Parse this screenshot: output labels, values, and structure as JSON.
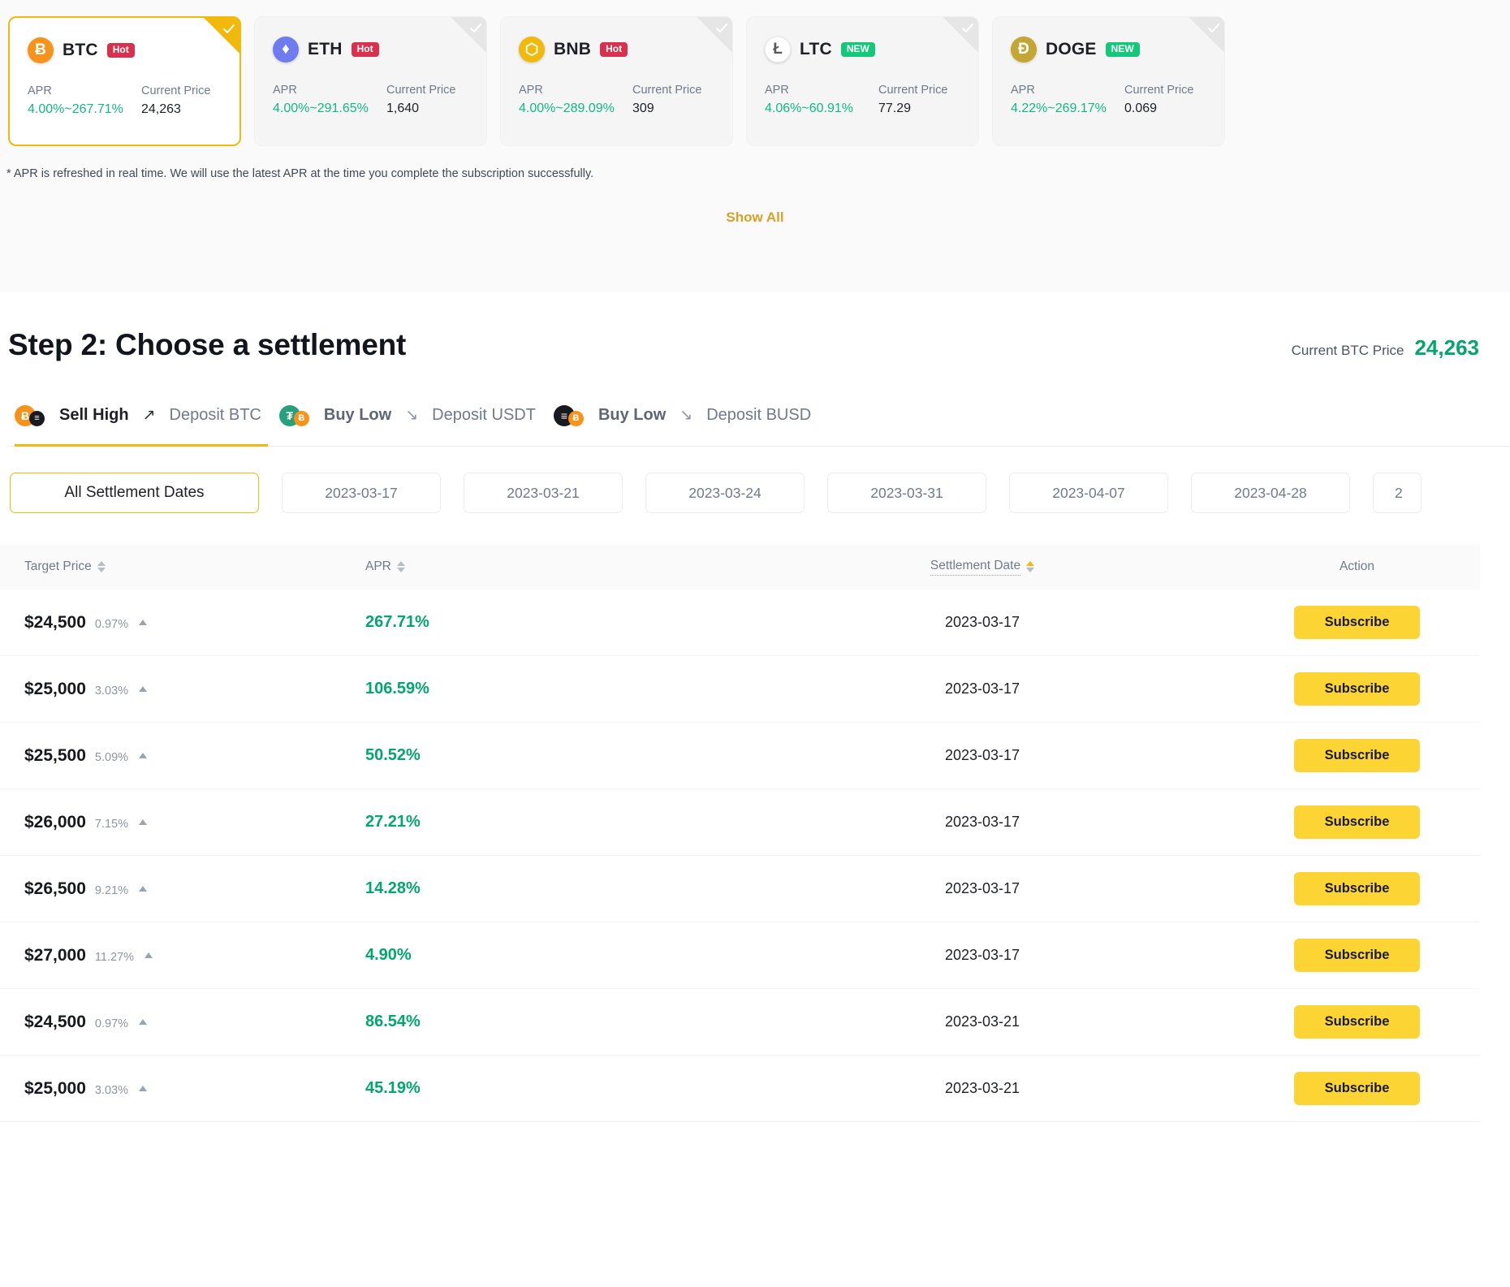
{
  "coin_cards": [
    {
      "symbol": "BTC",
      "badge": "Hot",
      "badge_type": "hot",
      "apr_label": "APR",
      "apr_value": "4.00%~267.71%",
      "price_label": "Current Price",
      "price_value": "24,263",
      "selected": true,
      "logo_glyph": "Ƀ",
      "logo_class": "logo-btc"
    },
    {
      "symbol": "ETH",
      "badge": "Hot",
      "badge_type": "hot",
      "apr_label": "APR",
      "apr_value": "4.00%~291.65%",
      "price_label": "Current Price",
      "price_value": "1,640",
      "selected": false,
      "logo_glyph": "♦",
      "logo_class": "logo-eth"
    },
    {
      "symbol": "BNB",
      "badge": "Hot",
      "badge_type": "hot",
      "apr_label": "APR",
      "apr_value": "4.00%~289.09%",
      "price_label": "Current Price",
      "price_value": "309",
      "selected": false,
      "logo_glyph": "⬡",
      "logo_class": "logo-bnb"
    },
    {
      "symbol": "LTC",
      "badge": "NEW",
      "badge_type": "new",
      "apr_label": "APR",
      "apr_value": "4.06%~60.91%",
      "price_label": "Current Price",
      "price_value": "77.29",
      "selected": false,
      "logo_glyph": "Ł",
      "logo_class": "logo-ltc"
    },
    {
      "symbol": "DOGE",
      "badge": "NEW",
      "badge_type": "new",
      "apr_label": "APR",
      "apr_value": "4.22%~269.17%",
      "price_label": "Current Price",
      "price_value": "0.069",
      "selected": false,
      "logo_glyph": "Đ",
      "logo_class": "logo-doge"
    }
  ],
  "apr_note": "* APR is refreshed in real time. We will use the latest APR at the time you complete the subscription successfully.",
  "show_all_label": "Show All",
  "step": {
    "title": "Step 2: Choose a settlement",
    "price_label": "Current BTC Price",
    "price_value": "24,263"
  },
  "settlement_tabs": [
    {
      "action": "Sell High",
      "arrow": "↗",
      "deposit": "Deposit BTC",
      "active": true,
      "icon_left": "Ƀ",
      "icon_left_class": "ic-btc",
      "icon_right": "≡",
      "icon_right_class": "ic-black"
    },
    {
      "action": "Buy Low",
      "arrow": "↘",
      "deposit": "Deposit USDT",
      "active": false,
      "icon_left": "₮",
      "icon_left_class": "ic-usdt",
      "icon_right": "Ƀ",
      "icon_right_class": "ic-btc"
    },
    {
      "action": "Buy Low",
      "arrow": "↘",
      "deposit": "Deposit BUSD",
      "active": false,
      "icon_left": "≡",
      "icon_left_class": "ic-black",
      "icon_right": "Ƀ",
      "icon_right_class": "ic-btc"
    }
  ],
  "date_filters": [
    {
      "label": "All Settlement Dates",
      "active": true,
      "clipped": false
    },
    {
      "label": "2023-03-17",
      "active": false,
      "clipped": false
    },
    {
      "label": "2023-03-21",
      "active": false,
      "clipped": false
    },
    {
      "label": "2023-03-24",
      "active": false,
      "clipped": false
    },
    {
      "label": "2023-03-31",
      "active": false,
      "clipped": false
    },
    {
      "label": "2023-04-07",
      "active": false,
      "clipped": false
    },
    {
      "label": "2023-04-28",
      "active": false,
      "clipped": false
    },
    {
      "label": "2",
      "active": false,
      "clipped": true
    }
  ],
  "table": {
    "columns": {
      "target_price": "Target Price",
      "apr": "APR",
      "settlement_date": "Settlement Date",
      "action": "Action"
    },
    "sort_active_column": "settlement_date",
    "rows": [
      {
        "target_price": "$24,500",
        "delta": "0.97%",
        "apr": "267.71%",
        "date": "2023-03-17",
        "button": "Subscribe"
      },
      {
        "target_price": "$25,000",
        "delta": "3.03%",
        "apr": "106.59%",
        "date": "2023-03-17",
        "button": "Subscribe"
      },
      {
        "target_price": "$25,500",
        "delta": "5.09%",
        "apr": "50.52%",
        "date": "2023-03-17",
        "button": "Subscribe"
      },
      {
        "target_price": "$26,000",
        "delta": "7.15%",
        "apr": "27.21%",
        "date": "2023-03-17",
        "button": "Subscribe"
      },
      {
        "target_price": "$26,500",
        "delta": "9.21%",
        "apr": "14.28%",
        "date": "2023-03-17",
        "button": "Subscribe"
      },
      {
        "target_price": "$27,000",
        "delta": "11.27%",
        "apr": "4.90%",
        "date": "2023-03-17",
        "button": "Subscribe"
      },
      {
        "target_price": "$24,500",
        "delta": "0.97%",
        "apr": "86.54%",
        "date": "2023-03-21",
        "button": "Subscribe"
      },
      {
        "target_price": "$25,000",
        "delta": "3.03%",
        "apr": "45.19%",
        "date": "2023-03-21",
        "button": "Subscribe"
      }
    ]
  },
  "colors": {
    "accent": "#f0b90b",
    "button": "#fcd535",
    "green": "#03a66d",
    "hot": "#d9304e",
    "new": "#14c77b"
  }
}
